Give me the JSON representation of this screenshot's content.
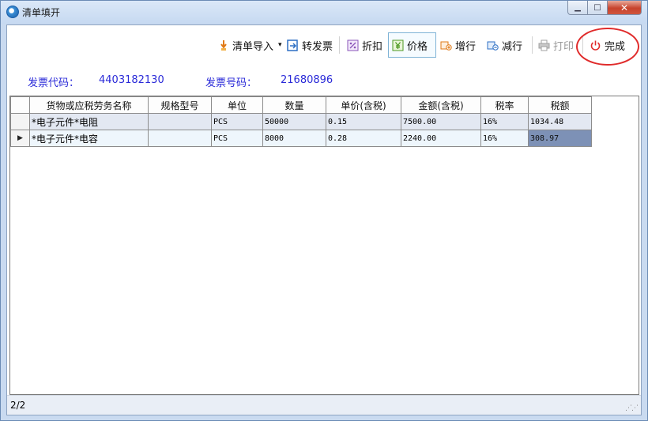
{
  "window": {
    "title": "清单填开",
    "icon": "app-logo-icon",
    "min_label": "▁",
    "max_label": "□",
    "close_label": "✕"
  },
  "toolbar": {
    "import_label": "清单导入",
    "import_arrow": "▾",
    "convert_label": "转发票",
    "discount_label": "折扣",
    "price_label": "价格",
    "add_row_label": "增行",
    "del_row_label": "减行",
    "print_label": "打印",
    "done_label": "完成"
  },
  "invoice": {
    "code_label": "发票代码：",
    "code_value": "4403182130",
    "number_label": "发票号码：",
    "number_value": "21680896"
  },
  "table": {
    "columns": [
      "货物或应税劳务名称",
      "规格型号",
      "单位",
      "数量",
      "单价(含税)",
      "金额(含税)",
      "税率",
      "税额"
    ],
    "rows": [
      {
        "indicator": "",
        "name": "*电子元件*电阻",
        "spec": "",
        "unit": "PCS",
        "qty": "50000",
        "price": "0.15",
        "amount": "7500.00",
        "rate": "16%",
        "tax": "1034.48"
      },
      {
        "indicator": "▶",
        "name": "*电子元件*电容",
        "spec": "",
        "unit": "PCS",
        "qty": "8000",
        "price": "0.28",
        "amount": "2240.00",
        "rate": "16%",
        "tax": "308.97"
      }
    ]
  },
  "status": {
    "text": "2/2"
  },
  "colors": {
    "info_text": "#2a2ad8",
    "highlight_circle": "#e02b2b",
    "selected_cell": "#7d91b6"
  }
}
